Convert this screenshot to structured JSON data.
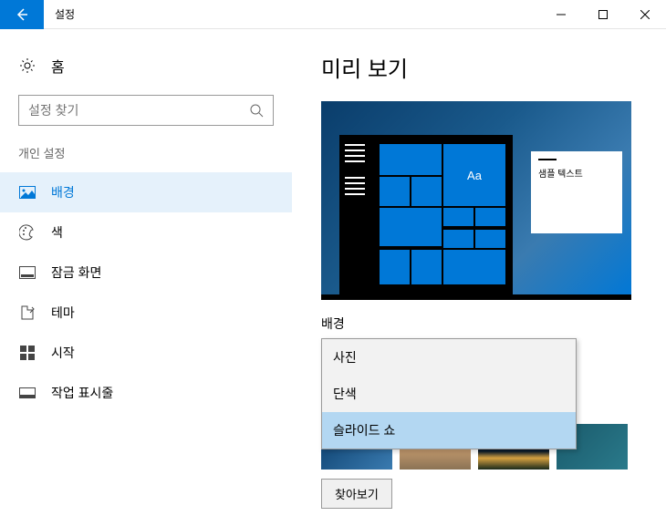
{
  "titlebar": {
    "title": "설정"
  },
  "sidebar": {
    "home_label": "홈",
    "search_placeholder": "설정 찾기",
    "category": "개인 설정",
    "items": [
      {
        "label": "배경"
      },
      {
        "label": "색"
      },
      {
        "label": "잠금 화면"
      },
      {
        "label": "테마"
      },
      {
        "label": "시작"
      },
      {
        "label": "작업 표시줄"
      }
    ]
  },
  "main": {
    "heading": "미리 보기",
    "preview_sample_text": "샘플 텍스트",
    "preview_aa": "Aa",
    "bg_label": "배경",
    "dropdown": {
      "options": [
        {
          "label": "사진"
        },
        {
          "label": "단색"
        },
        {
          "label": "슬라이드 쇼"
        }
      ]
    },
    "browse_label": "찾아보기"
  }
}
